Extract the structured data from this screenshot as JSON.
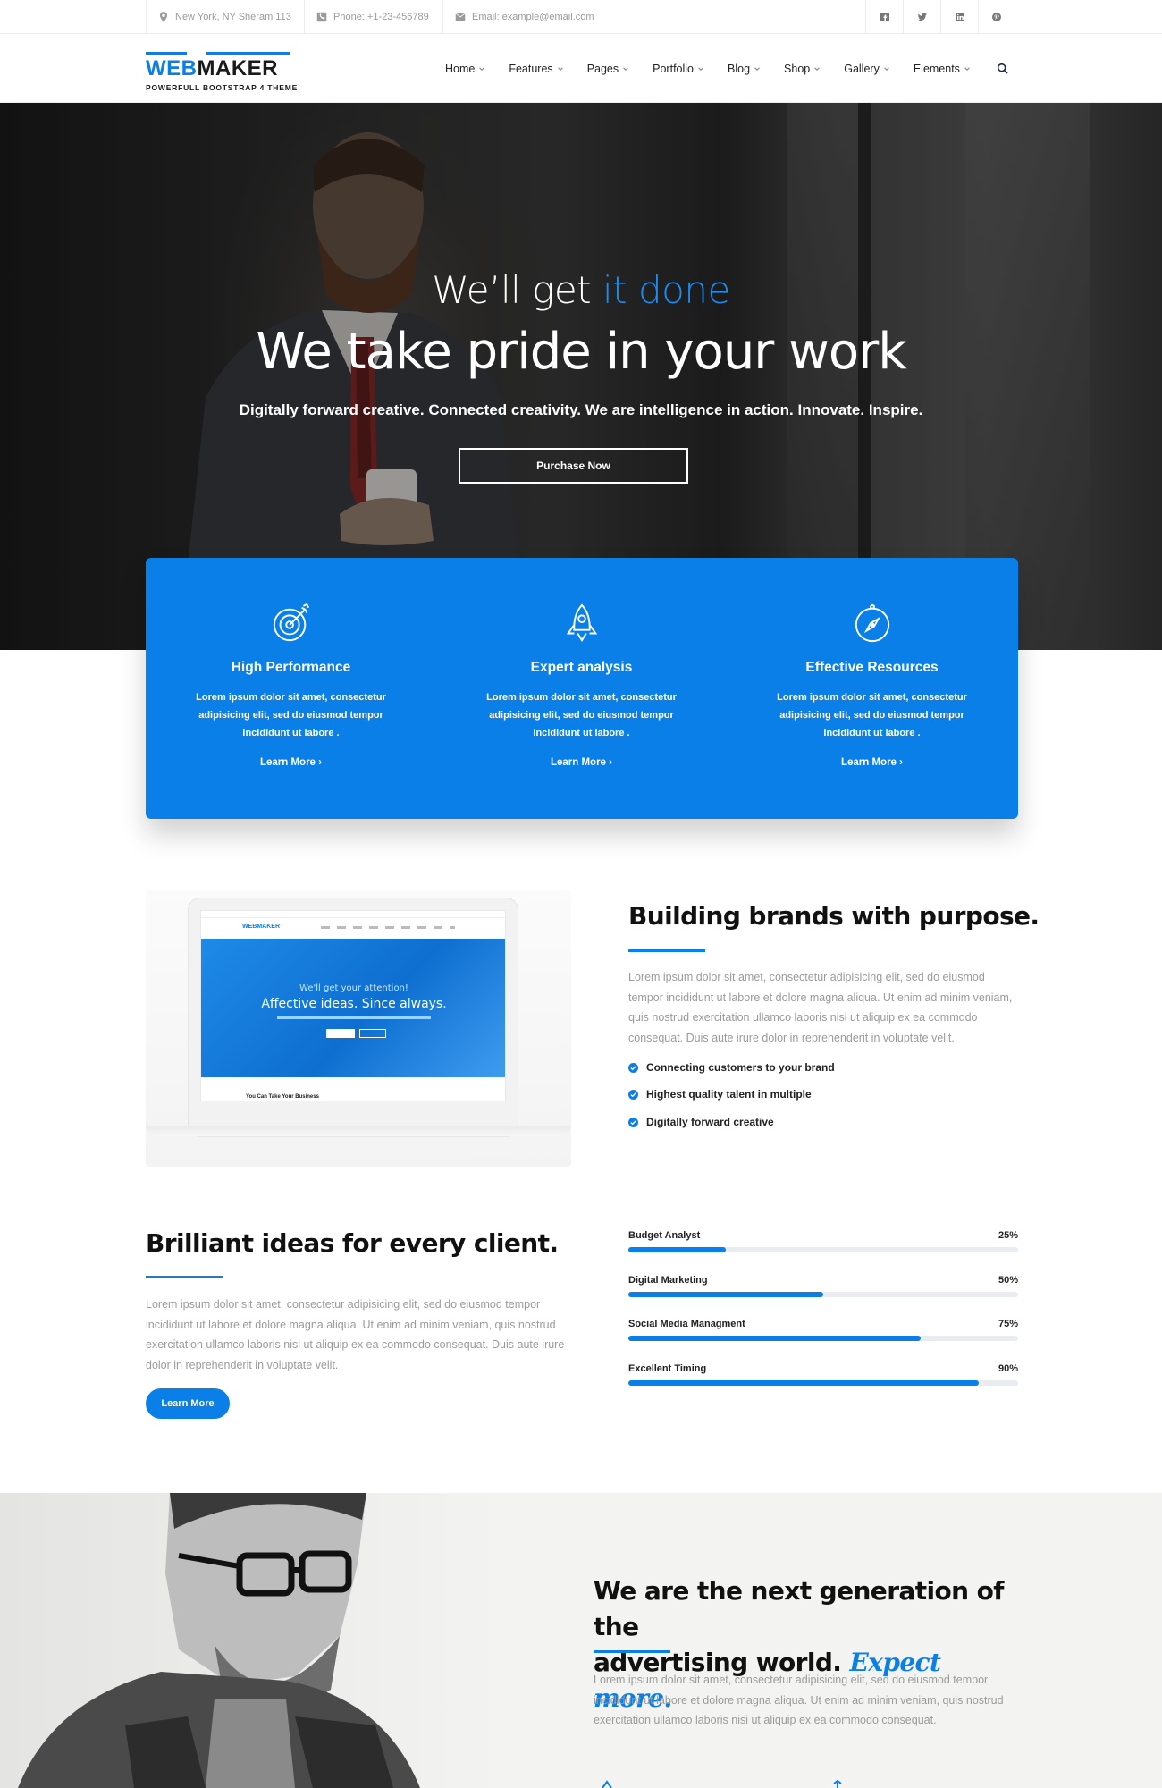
{
  "topbar": {
    "address": "New York, NY Sheram 113",
    "phone": "Phone: +1-23-456789",
    "email": "Email: example@email.com",
    "social_icons": [
      "facebook-icon",
      "twitter-icon",
      "linkedin-icon",
      "pinterest-icon"
    ]
  },
  "logo": {
    "word_blue": "WEB",
    "word_dark": "MAKER",
    "tagline": "POWERFULL BOOTSTRAP 4 THEME"
  },
  "nav": {
    "items": [
      "Home",
      "Features",
      "Pages",
      "Portfolio",
      "Blog",
      "Shop",
      "Gallery",
      "Elements"
    ],
    "search_icon": "search-icon"
  },
  "hero": {
    "kicker_plain": "We’ll get ",
    "kicker_highlight": "it done",
    "title": "We take pride in your work",
    "subtitle": "Digitally forward creative. Connected creativity. We are intelligence in action. Innovate. Inspire.",
    "button": "Purchase Now"
  },
  "features": [
    {
      "icon": "target-icon",
      "title": "High Performance",
      "text": "Lorem ipsum dolor sit amet, consectetur adipisicing elit, sed do eiusmod tempor incididunt ut labore .",
      "link": "Learn More"
    },
    {
      "icon": "rocket-icon",
      "title": "Expert analysis",
      "text": "Lorem ipsum dolor sit amet, consectetur adipisicing elit, sed do eiusmod tempor incididunt ut labore .",
      "link": "Learn More"
    },
    {
      "icon": "compass-icon",
      "title": "Effective Resources",
      "text": "Lorem ipsum dolor sit amet, consectetur adipisicing elit, sed do eiusmod tempor incididunt ut labore .",
      "link": "Learn More"
    }
  ],
  "laptop_preview": {
    "logo": "WEBMAKER",
    "kicker": "We'll get your attention!",
    "title": "Affective ideas. Since always.",
    "footer_text": "You Can Take Your Business"
  },
  "brands": {
    "title": "Building brands with purpose.",
    "text": "Lorem ipsum dolor sit amet, consectetur adipisicing elit, sed do eiusmod tempor incididunt ut labore et dolore magna aliqua. Ut enim ad minim veniam, quis nostrud exercitation ullamco laboris nisi ut aliquip ex ea commodo consequat. Duis aute irure dolor in reprehenderit in voluptate velit.",
    "checks": [
      "Connecting customers to your brand",
      "Highest quality talent in multiple",
      "Digitally forward creative"
    ]
  },
  "ideas": {
    "title": "Brilliant ideas for every client.",
    "text": "Lorem ipsum dolor sit amet, consectetur adipisicing elit, sed do eiusmod tempor incididunt ut labore et dolore magna aliqua. Ut enim ad minim veniam, quis nostrud exercitation ullamco laboris nisi ut aliquip ex ea commodo consequat. Duis aute irure dolor in reprehenderit in voluptate velit.",
    "button": "Learn More",
    "skills": [
      {
        "name": "Budget Analyst",
        "percent": 25,
        "label": "25%"
      },
      {
        "name": "Digital Marketing",
        "percent": 50,
        "label": "50%"
      },
      {
        "name": "Social Media Managment",
        "percent": 75,
        "label": "75%"
      },
      {
        "name": "Excellent Timing",
        "percent": 90,
        "label": "90%"
      }
    ]
  },
  "generation": {
    "title_line1": "We are the next generation of the",
    "title_line2": "advertising world.",
    "title_em": "Expect more.",
    "text": "Lorem ipsum dolor sit amet, consectetur adipisicing elit, sed do eiusmod tempor incididunt ut labore et dolore magna aliqua. Ut enim ad minim veniam, quis nostrud exercitation ullamco laboris nisi ut aliquip ex ea commodo consequat."
  },
  "colors": {
    "accent": "#0b7fe8",
    "text": "#222222",
    "muted": "#9b9b9b",
    "gen_bg": "#f3f3f1"
  }
}
